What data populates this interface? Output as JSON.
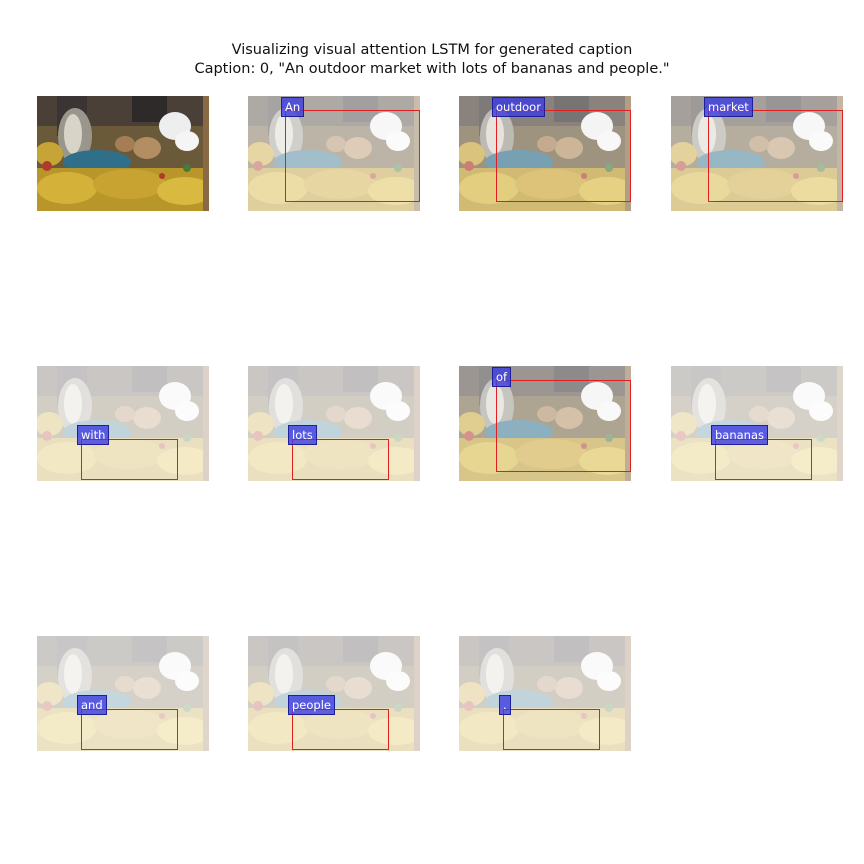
{
  "figure": {
    "title": "Visualizing visual attention LSTM for generated caption",
    "caption_line": "Caption: 0, \"An outdoor market with lots of bananas and people.\""
  },
  "colors": {
    "box": "#e02020",
    "label_bg": "#3c3ce1",
    "label_text": "#ffffff"
  },
  "tiles": [
    {
      "word": ""
    },
    {
      "word": "An"
    },
    {
      "word": "outdoor"
    },
    {
      "word": "market"
    },
    {
      "word": "with"
    },
    {
      "word": "lots"
    },
    {
      "word": "of"
    },
    {
      "word": "bananas"
    },
    {
      "word": "and"
    },
    {
      "word": "people"
    },
    {
      "word": "."
    }
  ]
}
